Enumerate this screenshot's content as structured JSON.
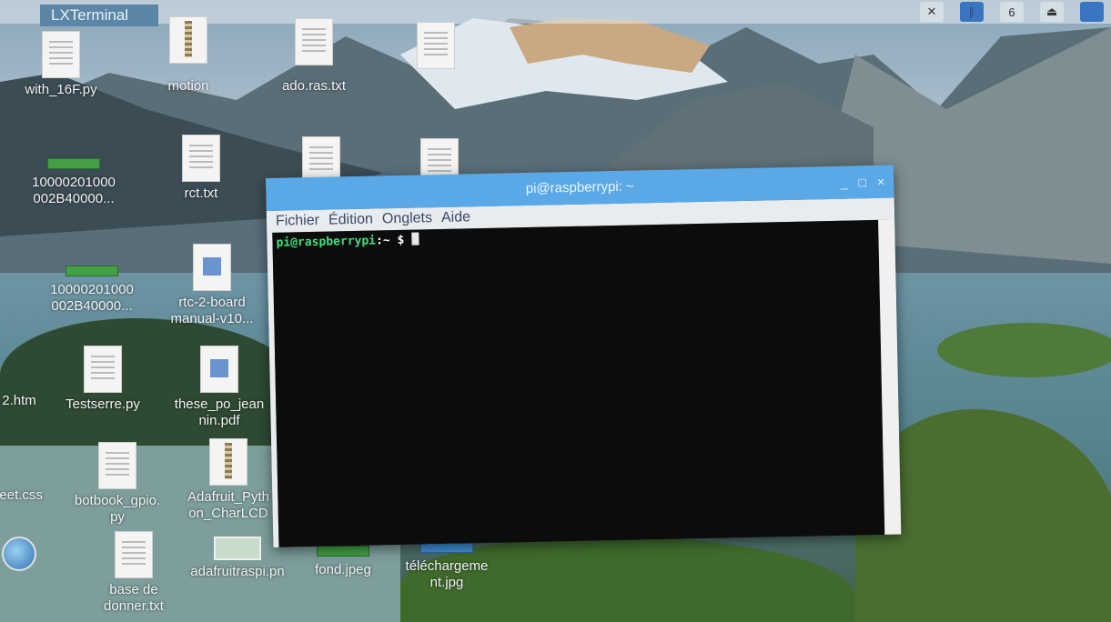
{
  "taskbar": {
    "window_label": "LXTerminal",
    "tray_value": "6"
  },
  "desktop_icons": [
    {
      "label": "with_16F.py"
    },
    {
      "label": "motion"
    },
    {
      "label": "ado.ras.txt"
    },
    {
      "label": "10000201000\n002B40000..."
    },
    {
      "label": "rct.txt"
    },
    {
      "label": "10000201000\n002B40000..."
    },
    {
      "label": "rtc-2-board\nmanual-v10..."
    },
    {
      "label": "2.htm"
    },
    {
      "label": "Testserre.py"
    },
    {
      "label": "these_po_jean\nnin.pdf"
    },
    {
      "label": "heet.css"
    },
    {
      "label": "botbook_gpio.\npy"
    },
    {
      "label": "Adafruit_Pyth\non_CharLCD"
    },
    {
      "label": "base de\ndonner.txt"
    },
    {
      "label": "adafruitraspi.pn"
    },
    {
      "label": "fond.jpeg"
    },
    {
      "label": "téléchargeme\nnt.jpg"
    }
  ],
  "terminal": {
    "title": "pi@raspberrypi: ~",
    "window_buttons": {
      "minimize": "_",
      "maximize": "□",
      "close": "×"
    },
    "menu": [
      "Fichier",
      "Édition",
      "Onglets",
      "Aide"
    ],
    "prompt_user": "pi@raspberrypi",
    "prompt_dir": ":~ $"
  }
}
